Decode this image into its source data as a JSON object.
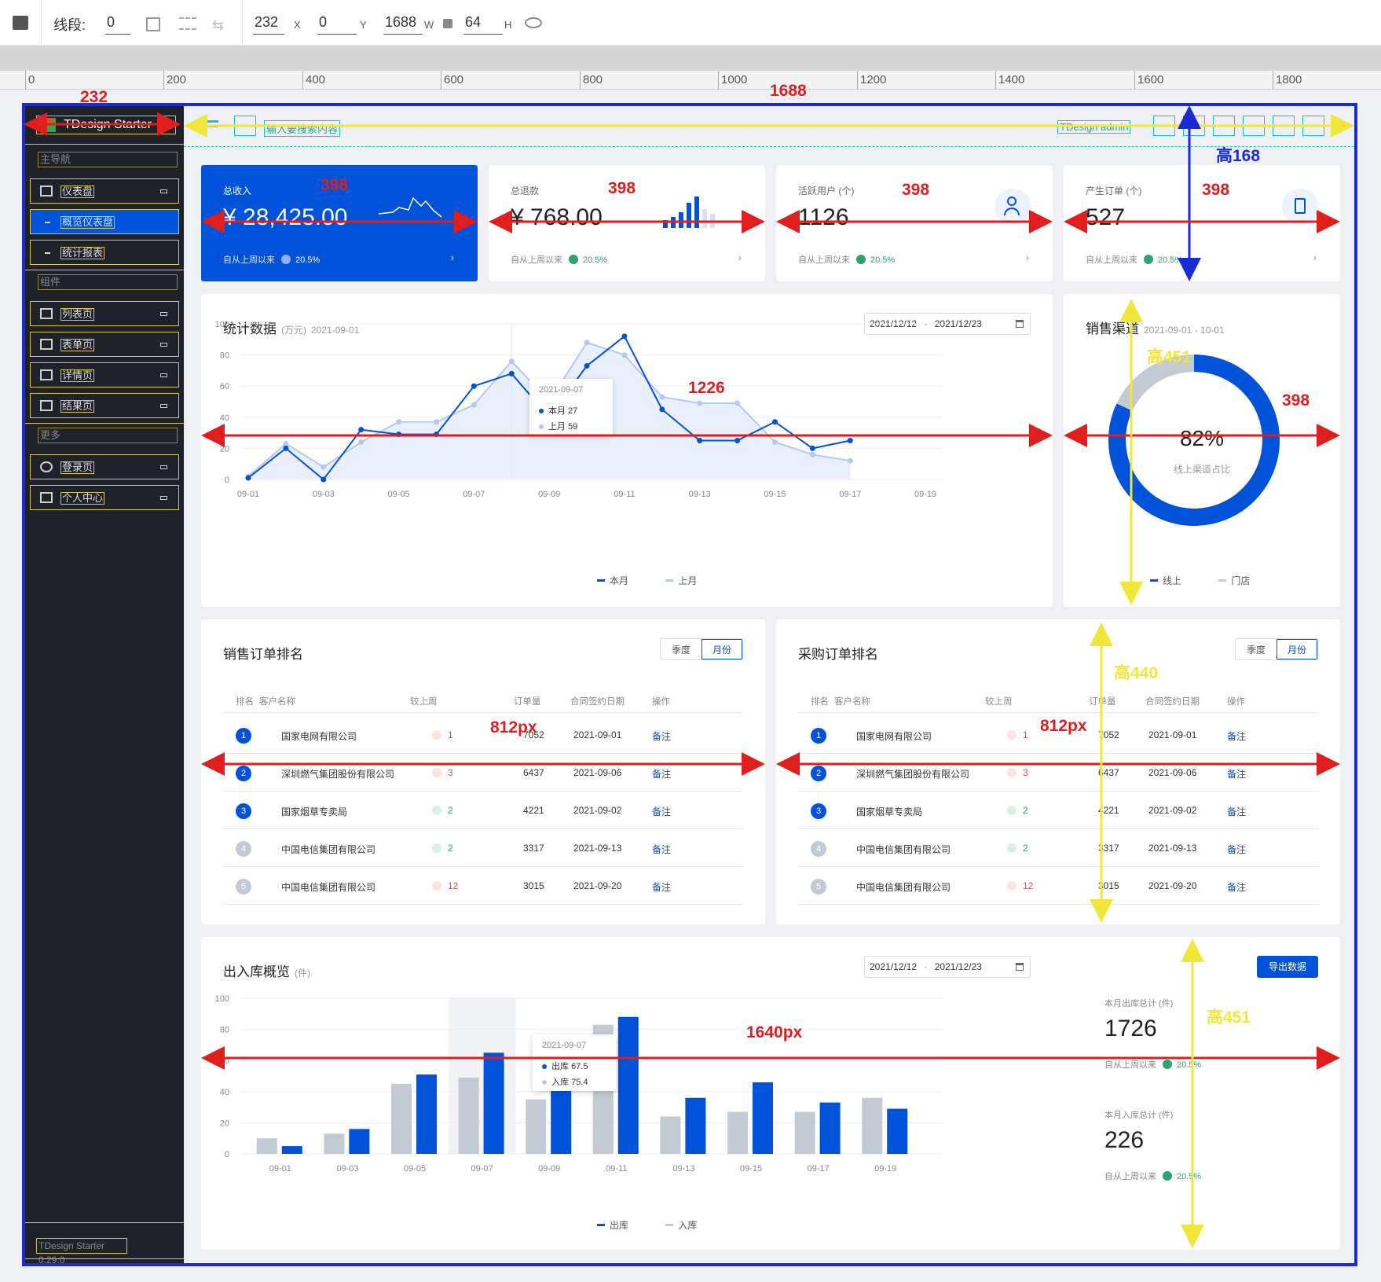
{
  "toolbar": {
    "segment_label": "线段:",
    "segment_value": "0",
    "x_value": "232",
    "x_label": "X",
    "y_value": "0",
    "y_label": "Y",
    "w_value": "1688",
    "w_label": "W",
    "h_value": "64",
    "h_label": "H"
  },
  "ruler": [
    "0",
    "200",
    "400",
    "600",
    "800",
    "1000",
    "1200",
    "1400",
    "1600",
    "1800"
  ],
  "sidebar": {
    "logo": "TDesign Starter",
    "groups": [
      "主导航",
      "组件",
      "更多"
    ],
    "items": [
      {
        "label": "仪表盘"
      },
      {
        "label": "概览仪表盘"
      },
      {
        "label": "统计报表"
      },
      {
        "label": "列表页"
      },
      {
        "label": "表单页"
      },
      {
        "label": "详情页"
      },
      {
        "label": "结果页"
      },
      {
        "label": "登录页"
      },
      {
        "label": "个人中心"
      }
    ],
    "version": "TDesign Starter 0.29.0"
  },
  "header": {
    "search_placeholder": "输入要搜索内容",
    "user": "TDesign admin"
  },
  "kpis": [
    {
      "title": "总收入",
      "value": "¥ 28,425.00",
      "foot": "自从上周以来",
      "pct": "20.5%"
    },
    {
      "title": "总退款",
      "value": "¥ 768.00",
      "foot": "自从上周以来",
      "pct": "20.5%"
    },
    {
      "title": "活跃用户 (个)",
      "value": "1126",
      "foot": "自从上周以来",
      "pct": "20.5%"
    },
    {
      "title": "产生订单 (个)",
      "value": "527",
      "foot": "自从上周以来",
      "pct": "20.5%"
    }
  ],
  "stats": {
    "title": "统计数据",
    "unit": "(万元)",
    "date": "2021-09-01",
    "range_start": "2021/12/12",
    "range_sep": "-",
    "range_end": "2021/12/23",
    "tooltip_date": "2021-09-07",
    "tooltip_a": "本月",
    "tooltip_a_val": "27",
    "tooltip_b": "上月",
    "tooltip_b_val": "59",
    "legend_a": "本月",
    "legend_b": "上月"
  },
  "channel": {
    "title": "销售渠道",
    "range": "2021-09-01 - 10-01",
    "percent": "82%",
    "caption": "线上渠道占比",
    "legend_a": "线上",
    "legend_b": "门店"
  },
  "sales_rank": {
    "title": "销售订单排名",
    "seg": [
      "季度",
      "月份"
    ],
    "headers": [
      "排名",
      "客户名称",
      "较上周",
      "订单量",
      "合同签约日期",
      "操作"
    ],
    "rows": [
      {
        "rank": "1",
        "name": "国家电网有限公司",
        "change": "1",
        "dir": "up",
        "orders": "7052",
        "date": "2021-09-01",
        "op": "备注"
      },
      {
        "rank": "2",
        "name": "深圳燃气集团股份有限公司",
        "change": "3",
        "dir": "up",
        "orders": "6437",
        "date": "2021-09-06",
        "op": "备注"
      },
      {
        "rank": "3",
        "name": "国家烟草专卖局",
        "change": "2",
        "dir": "dn",
        "orders": "4221",
        "date": "2021-09-02",
        "op": "备注"
      },
      {
        "rank": "4",
        "name": "中国电信集团有限公司",
        "change": "2",
        "dir": "dn",
        "orders": "3317",
        "date": "2021-09-13",
        "op": "备注"
      },
      {
        "rank": "5",
        "name": "中国电信集团有限公司",
        "change": "12",
        "dir": "up",
        "orders": "3015",
        "date": "2021-09-20",
        "op": "备注"
      }
    ]
  },
  "purchase_rank": {
    "title": "采购订单排名",
    "seg": [
      "季度",
      "月份"
    ],
    "headers": [
      "排名",
      "客户名称",
      "较上周",
      "订单量",
      "合同签约日期",
      "操作"
    ],
    "rows": [
      {
        "rank": "1",
        "name": "国家电网有限公司",
        "change": "1",
        "dir": "up",
        "orders": "7052",
        "date": "2021-09-01",
        "op": "备注"
      },
      {
        "rank": "2",
        "name": "深圳燃气集团股份有限公司",
        "change": "3",
        "dir": "up",
        "orders": "6437",
        "date": "2021-09-06",
        "op": "备注"
      },
      {
        "rank": "3",
        "name": "国家烟草专卖局",
        "change": "2",
        "dir": "dn",
        "orders": "4221",
        "date": "2021-09-02",
        "op": "备注"
      },
      {
        "rank": "4",
        "name": "中国电信集团有限公司",
        "change": "2",
        "dir": "dn",
        "orders": "3317",
        "date": "2021-09-13",
        "op": "备注"
      },
      {
        "rank": "5",
        "name": "中国电信集团有限公司",
        "change": "12",
        "dir": "up",
        "orders": "3015",
        "date": "2021-09-20",
        "op": "备注"
      }
    ]
  },
  "inout": {
    "title": "出入库概览",
    "unit": "(件)",
    "range_start": "2021/12/12",
    "range_sep": "-",
    "range_end": "2021/12/23",
    "export": "导出数据",
    "tooltip_date": "2021-09-07",
    "tooltip_a": "出库",
    "tooltip_a_val": "67.5",
    "tooltip_b": "入库",
    "tooltip_b_val": "75.4",
    "legend_a": "出库",
    "legend_b": "入库",
    "out_label": "本月出库总计 (件)",
    "out_value": "1726",
    "in_label": "本月入库总计 (件)",
    "in_value": "226",
    "foot": "自从上周以来",
    "pct": "20.5%"
  },
  "annotations": {
    "w232": "232",
    "w1688": "1688",
    "h168": "高168",
    "w398": "398",
    "w1226": "1226",
    "h451": "高451",
    "h440": "高440",
    "w812": "812px",
    "w1640": "1640px"
  },
  "colors": {
    "primary": "#0052d9",
    "light": "#b5c7f5",
    "gray": "#c4cad3",
    "annotation_red": "#e01e1e",
    "annotation_yellow": "#f1e73a",
    "frame_blue": "#1a2bd6"
  },
  "chart_data": [
    {
      "type": "line",
      "title": "统计数据",
      "ylim": [
        0,
        100
      ],
      "yticks": [
        0,
        20,
        40,
        60,
        80,
        100
      ],
      "x": [
        "09-01",
        "09-02",
        "09-03",
        "09-04",
        "09-05",
        "09-06",
        "09-07",
        "09-08",
        "09-09",
        "09-10",
        "09-11",
        "09-12",
        "09-13",
        "09-14",
        "09-15",
        "09-16"
      ],
      "xticks": [
        "09-01",
        "09-03",
        "09-05",
        "09-07",
        "09-09",
        "09-11",
        "09-13",
        "09-15",
        "09-17",
        "09-19"
      ],
      "series": [
        {
          "name": "本月",
          "values": [
            1,
            20,
            0,
            32,
            29,
            29,
            60,
            68,
            40,
            73,
            92,
            45,
            25,
            25,
            37,
            20,
            25
          ]
        },
        {
          "name": "上月",
          "values": [
            2,
            23,
            8,
            24,
            37,
            37,
            48,
            76,
            50,
            88,
            80,
            53,
            49,
            49,
            24,
            16,
            12
          ]
        }
      ]
    },
    {
      "type": "pie",
      "title": "销售渠道",
      "series": [
        {
          "name": "线上",
          "values": [
            82
          ]
        },
        {
          "name": "门店",
          "values": [
            18
          ]
        }
      ]
    },
    {
      "type": "bar",
      "title": "出入库概览",
      "ylim": [
        0,
        100
      ],
      "yticks": [
        0,
        20,
        40,
        60,
        80,
        100
      ],
      "categories": [
        "09-01",
        "09-03",
        "09-05",
        "09-07",
        "09-09",
        "09-11",
        "09-13",
        "09-15",
        "09-17",
        "09-19"
      ],
      "series": [
        {
          "name": "入库",
          "values": [
            10,
            13,
            45,
            49,
            35,
            83,
            24,
            27,
            27,
            36
          ]
        },
        {
          "name": "出库",
          "values": [
            5,
            16,
            51,
            65,
            65,
            88,
            36,
            46,
            33,
            29
          ]
        }
      ]
    }
  ]
}
